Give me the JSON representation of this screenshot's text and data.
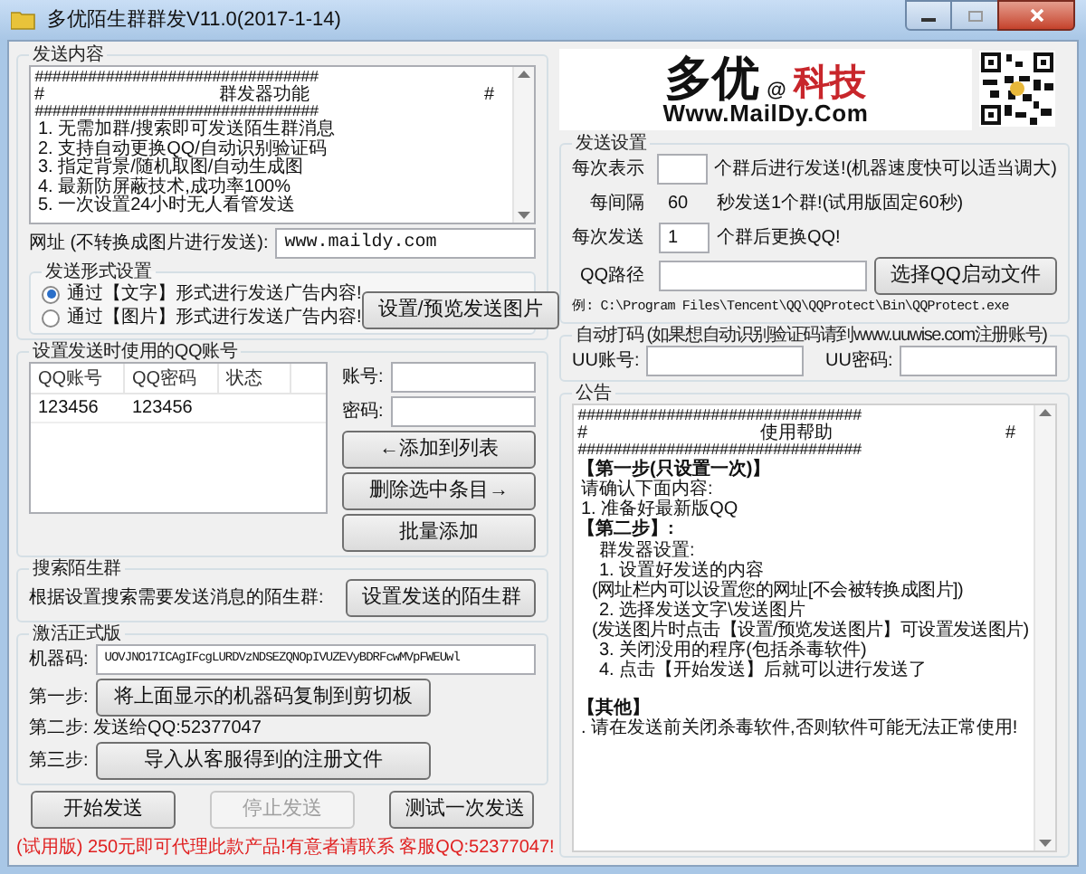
{
  "window": {
    "title": "多优陌生群群发V11.0(2017-1-14)"
  },
  "content": {
    "title": "发送内容",
    "lines": [
      {
        "kind": "rule",
        "text": "################################"
      },
      {
        "kind": "banner",
        "left": "#",
        "text": "群发器功能",
        "right": "#"
      },
      {
        "kind": "rule",
        "text": "################################"
      },
      {
        "kind": "text",
        "text": "1. 无需加群/搜索即可发送陌生群消息"
      },
      {
        "kind": "text",
        "text": "2. 支持自动更换QQ/自动识别验证码"
      },
      {
        "kind": "text",
        "text": "3. 指定背景/随机取图/自动生成图"
      },
      {
        "kind": "text",
        "text": "4. 最新防屏蔽技术,成功率100%"
      },
      {
        "kind": "text",
        "text": "5. 一次设置24小时无人看管发送"
      }
    ],
    "url_label": "网址 (不转换成图片进行发送):",
    "url_value": "www.maildy.com"
  },
  "format": {
    "title": "发送形式设置",
    "options": [
      {
        "label": "通过【文字】形式进行发送广告内容!",
        "selected": true
      },
      {
        "label": "通过【图片】形式进行发送广告内容!",
        "selected": false
      }
    ],
    "button": "设置/预览发送图片"
  },
  "accounts": {
    "title": "设置发送时使用的QQ账号",
    "columns": [
      "QQ账号",
      "QQ密码",
      "状态"
    ],
    "rows": [
      [
        "123456",
        "123456"
      ]
    ],
    "account_label": "账号:",
    "password_label": "密码:",
    "buttons": [
      "←添加到列表",
      "删除选中条目→",
      "批量添加"
    ]
  },
  "search": {
    "title": "搜索陌生群",
    "label": "根据设置搜索需要发送消息的陌生群:",
    "button": "设置发送的陌生群"
  },
  "activate": {
    "title": "激活正式版",
    "machine_label": "机器码:",
    "machine_code": "UOVJNO17ICAgIFcgLURDVzNDSEZQNOpIVUZEVyBDRFcwMVpFWEUwl",
    "step1_label": "第一步:",
    "step1_button": "将上面显示的机器码复制到剪切板",
    "step2": "第二步: 发送给QQ:52377047",
    "step3_label": "第三步:",
    "step3_button": "导入从客服得到的注册文件"
  },
  "actions": [
    {
      "label": "开始发送",
      "disabled": false
    },
    {
      "label": "停止发送",
      "disabled": true
    },
    {
      "label": "测试一次发送",
      "disabled": false
    }
  ],
  "footer": "(试用版)  250元即可代理此款产品!有意者请联系 客服QQ:52377047!",
  "logo": {
    "brand": "多优",
    "at": "@",
    "tech": "科技",
    "url": "Www.MailDy.Com"
  },
  "send_settings": {
    "title": "发送设置",
    "every_label": "每次表示",
    "every_suffix": "个群后进行发送!(机器速度快可以适当调大)",
    "interval_label": "每间隔",
    "interval_value": "60",
    "interval_suffix": "秒发送1个群!(试用版固定60秒)",
    "switch_label": "每次发送",
    "switch_value": "1",
    "switch_suffix": "个群后更换QQ!",
    "path_label": "QQ路径",
    "path_button": "选择QQ启动文件",
    "example": "例: C:\\Program Files\\Tencent\\QQ\\QQProtect\\Bin\\QQProtect.exe"
  },
  "captcha": {
    "title": "自动打码 (如果想自动识别验证码请到www.uuwise.com注册账号)",
    "account_label": "UU账号:",
    "password_label": "UU密码:"
  },
  "notice": {
    "title": "公告",
    "lines": [
      {
        "kind": "rule",
        "text": "################################"
      },
      {
        "kind": "banner",
        "left": "#",
        "text": "使用帮助",
        "right": "#"
      },
      {
        "kind": "rule",
        "text": "################################"
      },
      {
        "kind": "heading",
        "text": "【第一步(只设置一次)】"
      },
      {
        "kind": "text",
        "text": "请确认下面内容:"
      },
      {
        "kind": "text",
        "text": "1. 准备好最新版QQ"
      },
      {
        "kind": "heading",
        "text": "【第二步】:"
      },
      {
        "kind": "indent",
        "text": "群发器设置:"
      },
      {
        "kind": "indent",
        "text": "1. 设置好发送的内容"
      },
      {
        "kind": "indent2",
        "text": "(网址栏内可以设置您的网址[不会被转换成图片])"
      },
      {
        "kind": "indent",
        "text": "2. 选择发送文字\\发送图片"
      },
      {
        "kind": "indent2",
        "text": "(发送图片时点击【设置/预览发送图片】可设置发送图片)"
      },
      {
        "kind": "indent",
        "text": "3. 关闭没用的程序(包括杀毒软件)"
      },
      {
        "kind": "indent",
        "text": "4. 点击【开始发送】后就可以进行发送了"
      },
      {
        "kind": "blank"
      },
      {
        "kind": "heading",
        "text": "【其他】"
      },
      {
        "kind": "text",
        "text": ". 请在发送前关闭杀毒软件,否则软件可能无法正常使用!"
      }
    ]
  }
}
